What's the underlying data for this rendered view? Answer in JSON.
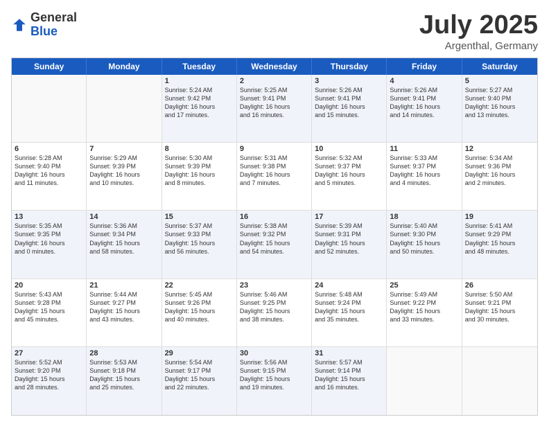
{
  "logo": {
    "general": "General",
    "blue": "Blue"
  },
  "title": "July 2025",
  "subtitle": "Argenthal, Germany",
  "header_days": [
    "Sunday",
    "Monday",
    "Tuesday",
    "Wednesday",
    "Thursday",
    "Friday",
    "Saturday"
  ],
  "rows": [
    [
      {
        "date": "",
        "info": "",
        "empty": true
      },
      {
        "date": "",
        "info": "",
        "empty": true
      },
      {
        "date": "1",
        "info": "Sunrise: 5:24 AM\nSunset: 9:42 PM\nDaylight: 16 hours\nand 17 minutes."
      },
      {
        "date": "2",
        "info": "Sunrise: 5:25 AM\nSunset: 9:41 PM\nDaylight: 16 hours\nand 16 minutes."
      },
      {
        "date": "3",
        "info": "Sunrise: 5:26 AM\nSunset: 9:41 PM\nDaylight: 16 hours\nand 15 minutes."
      },
      {
        "date": "4",
        "info": "Sunrise: 5:26 AM\nSunset: 9:41 PM\nDaylight: 16 hours\nand 14 minutes."
      },
      {
        "date": "5",
        "info": "Sunrise: 5:27 AM\nSunset: 9:40 PM\nDaylight: 16 hours\nand 13 minutes."
      }
    ],
    [
      {
        "date": "6",
        "info": "Sunrise: 5:28 AM\nSunset: 9:40 PM\nDaylight: 16 hours\nand 11 minutes."
      },
      {
        "date": "7",
        "info": "Sunrise: 5:29 AM\nSunset: 9:39 PM\nDaylight: 16 hours\nand 10 minutes."
      },
      {
        "date": "8",
        "info": "Sunrise: 5:30 AM\nSunset: 9:39 PM\nDaylight: 16 hours\nand 8 minutes."
      },
      {
        "date": "9",
        "info": "Sunrise: 5:31 AM\nSunset: 9:38 PM\nDaylight: 16 hours\nand 7 minutes."
      },
      {
        "date": "10",
        "info": "Sunrise: 5:32 AM\nSunset: 9:37 PM\nDaylight: 16 hours\nand 5 minutes."
      },
      {
        "date": "11",
        "info": "Sunrise: 5:33 AM\nSunset: 9:37 PM\nDaylight: 16 hours\nand 4 minutes."
      },
      {
        "date": "12",
        "info": "Sunrise: 5:34 AM\nSunset: 9:36 PM\nDaylight: 16 hours\nand 2 minutes."
      }
    ],
    [
      {
        "date": "13",
        "info": "Sunrise: 5:35 AM\nSunset: 9:35 PM\nDaylight: 16 hours\nand 0 minutes."
      },
      {
        "date": "14",
        "info": "Sunrise: 5:36 AM\nSunset: 9:34 PM\nDaylight: 15 hours\nand 58 minutes."
      },
      {
        "date": "15",
        "info": "Sunrise: 5:37 AM\nSunset: 9:33 PM\nDaylight: 15 hours\nand 56 minutes."
      },
      {
        "date": "16",
        "info": "Sunrise: 5:38 AM\nSunset: 9:32 PM\nDaylight: 15 hours\nand 54 minutes."
      },
      {
        "date": "17",
        "info": "Sunrise: 5:39 AM\nSunset: 9:31 PM\nDaylight: 15 hours\nand 52 minutes."
      },
      {
        "date": "18",
        "info": "Sunrise: 5:40 AM\nSunset: 9:30 PM\nDaylight: 15 hours\nand 50 minutes."
      },
      {
        "date": "19",
        "info": "Sunrise: 5:41 AM\nSunset: 9:29 PM\nDaylight: 15 hours\nand 48 minutes."
      }
    ],
    [
      {
        "date": "20",
        "info": "Sunrise: 5:43 AM\nSunset: 9:28 PM\nDaylight: 15 hours\nand 45 minutes."
      },
      {
        "date": "21",
        "info": "Sunrise: 5:44 AM\nSunset: 9:27 PM\nDaylight: 15 hours\nand 43 minutes."
      },
      {
        "date": "22",
        "info": "Sunrise: 5:45 AM\nSunset: 9:26 PM\nDaylight: 15 hours\nand 40 minutes."
      },
      {
        "date": "23",
        "info": "Sunrise: 5:46 AM\nSunset: 9:25 PM\nDaylight: 15 hours\nand 38 minutes."
      },
      {
        "date": "24",
        "info": "Sunrise: 5:48 AM\nSunset: 9:24 PM\nDaylight: 15 hours\nand 35 minutes."
      },
      {
        "date": "25",
        "info": "Sunrise: 5:49 AM\nSunset: 9:22 PM\nDaylight: 15 hours\nand 33 minutes."
      },
      {
        "date": "26",
        "info": "Sunrise: 5:50 AM\nSunset: 9:21 PM\nDaylight: 15 hours\nand 30 minutes."
      }
    ],
    [
      {
        "date": "27",
        "info": "Sunrise: 5:52 AM\nSunset: 9:20 PM\nDaylight: 15 hours\nand 28 minutes."
      },
      {
        "date": "28",
        "info": "Sunrise: 5:53 AM\nSunset: 9:18 PM\nDaylight: 15 hours\nand 25 minutes."
      },
      {
        "date": "29",
        "info": "Sunrise: 5:54 AM\nSunset: 9:17 PM\nDaylight: 15 hours\nand 22 minutes."
      },
      {
        "date": "30",
        "info": "Sunrise: 5:56 AM\nSunset: 9:15 PM\nDaylight: 15 hours\nand 19 minutes."
      },
      {
        "date": "31",
        "info": "Sunrise: 5:57 AM\nSunset: 9:14 PM\nDaylight: 15 hours\nand 16 minutes."
      },
      {
        "date": "",
        "info": "",
        "empty": true
      },
      {
        "date": "",
        "info": "",
        "empty": true
      }
    ]
  ],
  "alt_rows": [
    0,
    2,
    4
  ]
}
